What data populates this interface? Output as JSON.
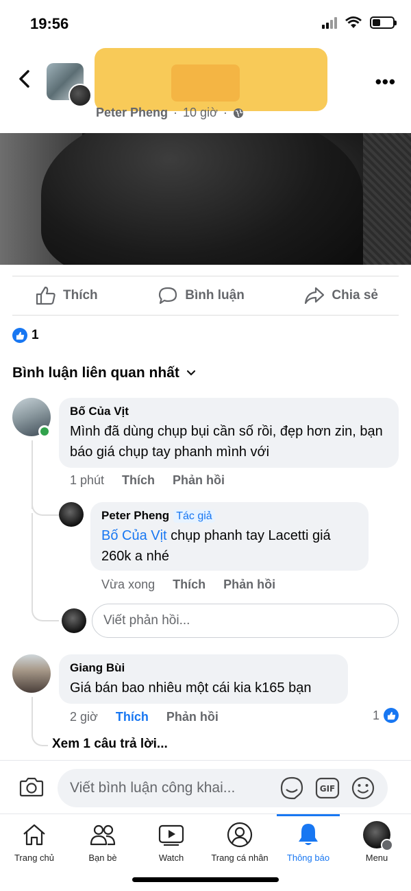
{
  "status_bar": {
    "time": "19:56"
  },
  "post": {
    "author": "Peter Pheng",
    "time": "10 giờ",
    "like_count": "1"
  },
  "actions": {
    "like": "Thích",
    "comment": "Bình luận",
    "share": "Chia sẻ"
  },
  "comments_sort": "Bình luận liên quan nhất",
  "comments": [
    {
      "name": "Bố Của Vịt",
      "text": "Mình đã dùng chụp bụi cần số rồi, đẹp hơn zin, bạn báo giá chụp tay phanh mình với",
      "time": "1 phút",
      "like": "Thích",
      "reply": "Phản hồi"
    },
    {
      "name": "Giang Bùi",
      "text": "Giá bán bao nhiêu một cái kia k165 bạn",
      "time": "2 giờ",
      "like": "Thích",
      "reply": "Phản hồi",
      "reaction_count": "1",
      "see_replies": "Xem 1 câu trả lời..."
    }
  ],
  "reply": {
    "name": "Peter Pheng",
    "author_tag": "Tác giả",
    "mention": "Bố Của Vịt",
    "text": " chụp phanh tay Lacetti giá 260k a nhé",
    "time": "Vừa xong",
    "like": "Thích",
    "reply": "Phản hồi"
  },
  "reply_input_placeholder": "Viết phản hồi...",
  "compose_placeholder": "Viết bình luận công khai...",
  "tabs": [
    {
      "label": "Trang chủ",
      "icon": "home-icon"
    },
    {
      "label": "Bạn bè",
      "icon": "friends-icon"
    },
    {
      "label": "Watch",
      "icon": "watch-icon"
    },
    {
      "label": "Trang cá nhân",
      "icon": "profile-icon"
    },
    {
      "label": "Thông báo",
      "icon": "bell-icon",
      "active": true
    },
    {
      "label": "Menu",
      "icon": "menu-avatar"
    }
  ],
  "colors": {
    "accent": "#1877f2",
    "secondary_text": "#65676b",
    "bubble": "#f0f2f5",
    "online": "#31a24c"
  }
}
